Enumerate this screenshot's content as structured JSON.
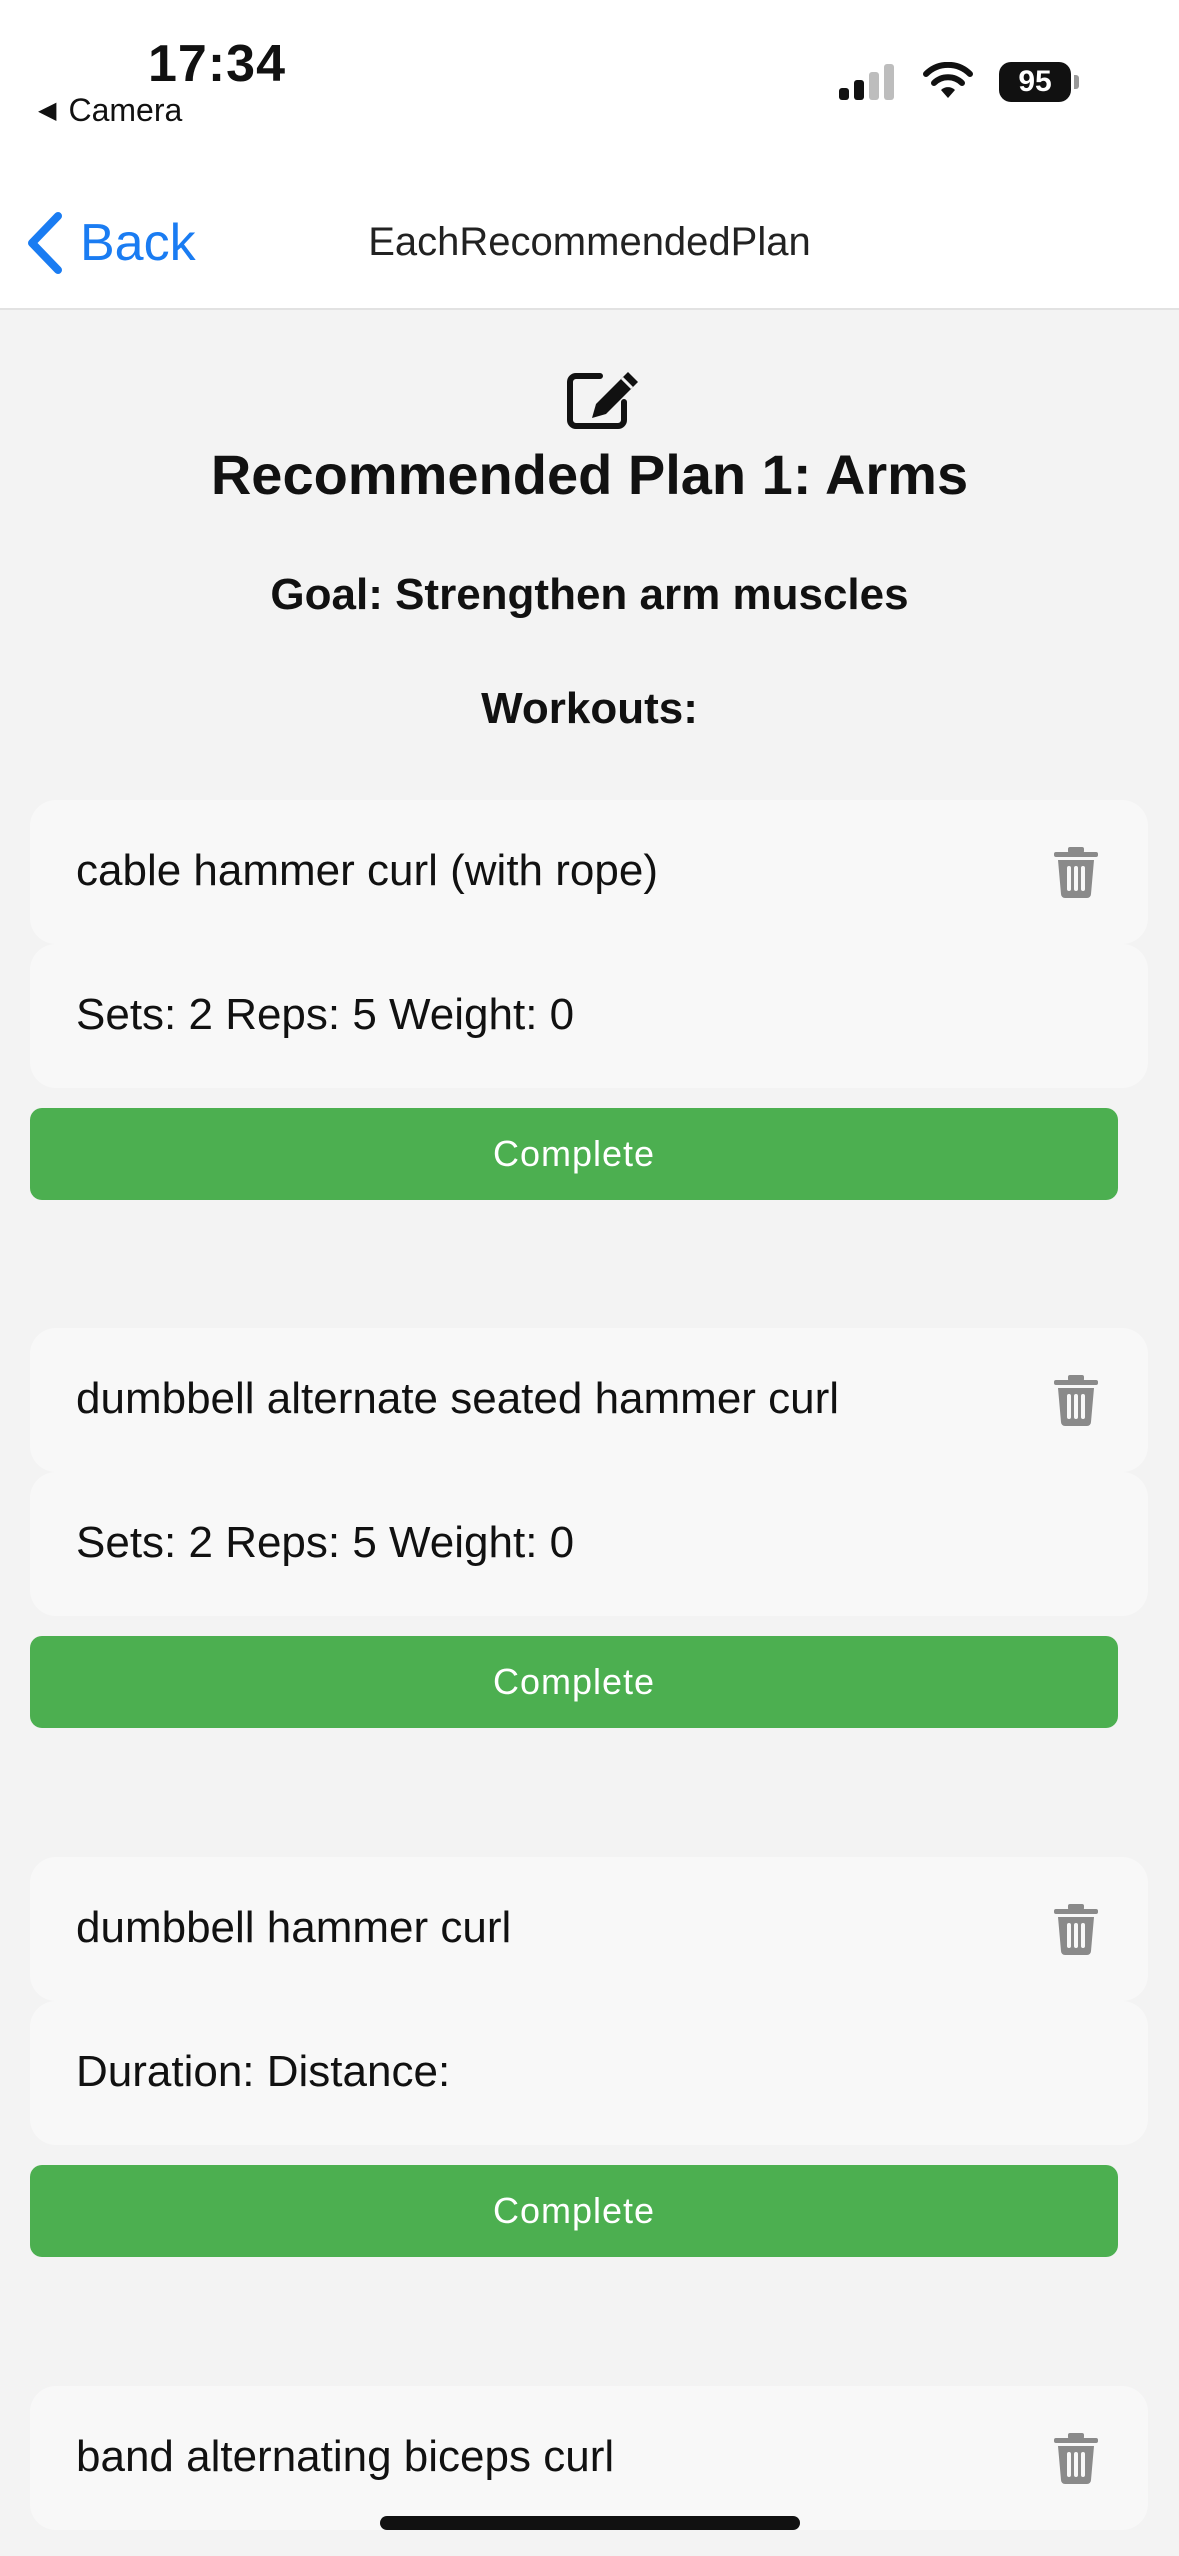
{
  "status_bar": {
    "time": "17:34",
    "back_app": "Camera",
    "back_arrow_icon": "triangle-left-icon",
    "battery": "95",
    "icons": [
      "signal-icon",
      "wifi-icon",
      "battery-icon"
    ]
  },
  "nav": {
    "back_label": "Back",
    "title": "EachRecommendedPlan"
  },
  "plan": {
    "edit_icon": "edit-icon",
    "title": "Recommended Plan 1: Arms",
    "goal": "Goal: Strengthen arm muscles",
    "workouts_label": "Workouts:"
  },
  "workouts": [
    {
      "name": "cable hammer curl (with rope)",
      "detail": "Sets: 2 Reps: 5 Weight: 0",
      "action": "Complete"
    },
    {
      "name": "dumbbell alternate seated hammer curl",
      "detail": "Sets: 2 Reps: 5 Weight: 0",
      "action": "Complete"
    },
    {
      "name": "dumbbell hammer curl",
      "detail": "Duration:  Distance:",
      "action": "Complete"
    },
    {
      "name": "band alternating biceps curl"
    }
  ],
  "colors": {
    "accent_blue": "#1a7cf2",
    "complete_green": "#4caf50",
    "background": "#f3f3f3",
    "card": "#f8f8f8",
    "trash_gray": "#8a8a8a"
  }
}
